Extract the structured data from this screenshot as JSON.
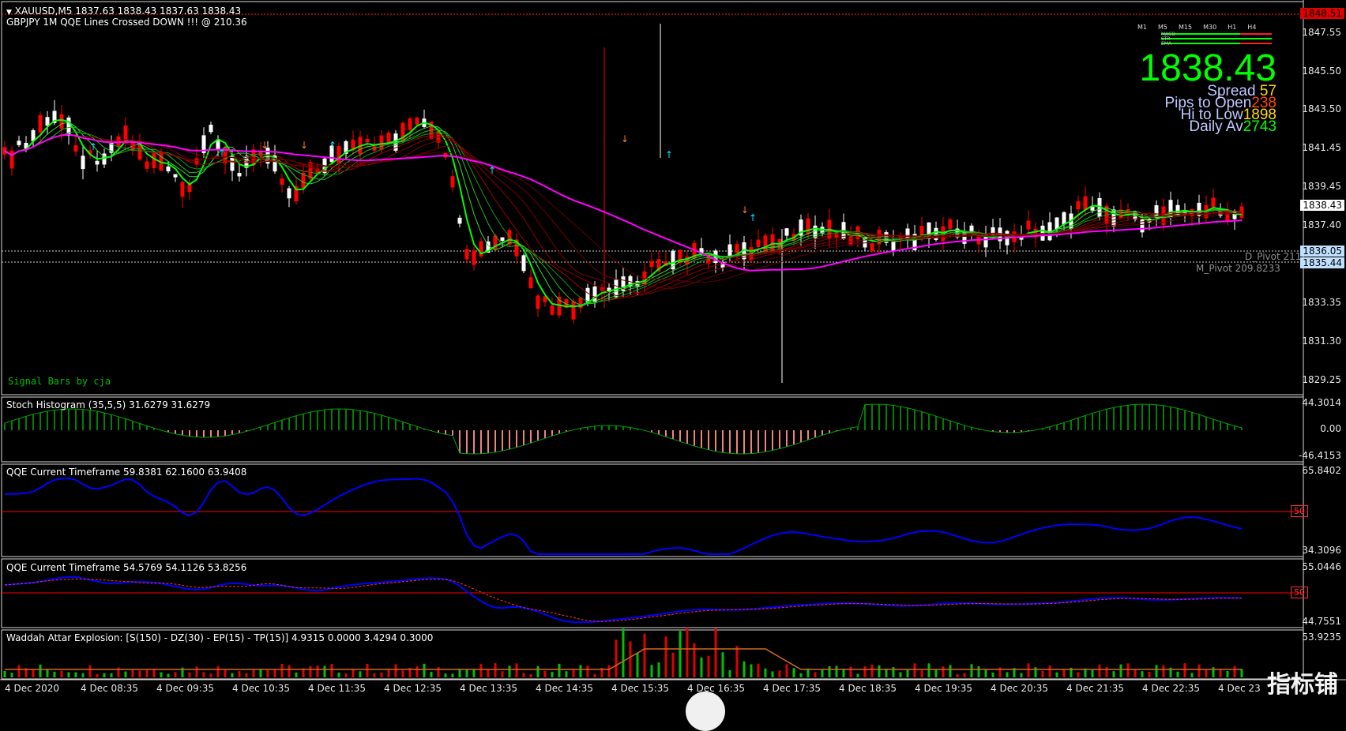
{
  "main_panel": {
    "title": "XAUUSD,M5  1837.63 1838.43 1837.63 1838.43",
    "subtitle": "GBPJPY 1M    QQE Lines Crossed DOWN !!!   @   210.36",
    "signal_text": "Signal Bars by cja",
    "big_price": "1838.43",
    "spread_label": "Spread",
    "spread_value": "57",
    "pips_label": "Pips to Open",
    "pips_value": "238",
    "hilow_label": "Hi to Low",
    "hilow_value": "1898",
    "daily_label": "Daily Av",
    "daily_value": "2743",
    "d_pivot": "D_Pivot 211",
    "m_pivot": "M_Pivot 209.8233",
    "top_price_badge": "1848.51",
    "current_price_badge": "1838.43",
    "pivot_badge_1": "1836.05",
    "pivot_badge_2": "1835.44",
    "y_ticks": [
      "1847.55",
      "1845.50",
      "1843.50",
      "1841.45",
      "1839.45",
      "1837.40",
      "1833.35",
      "1831.30",
      "1829.25"
    ],
    "timeframes": [
      "M1",
      "M5",
      "M15",
      "M30",
      "H1",
      "H4"
    ],
    "tf_rows": [
      "MACD",
      "STR",
      "EMA"
    ]
  },
  "stoch_panel": {
    "title": "Stoch Histogram (35,5,5) 31.6279 31.6279",
    "y_ticks": [
      "44.3014",
      "0.00",
      "-46.4153"
    ]
  },
  "qqe1_panel": {
    "title": "QQE Current Timeframe 59.8381 62.1600 63.9408",
    "y_ticks": [
      "65.8402",
      "34.3096"
    ],
    "level": "50"
  },
  "qqe2_panel": {
    "title": "QQE Current Timeframe 54.5769 54.1126 53.8256",
    "y_ticks": [
      "55.0446",
      "44.7551"
    ],
    "level": "50"
  },
  "waddah_panel": {
    "title": "Waddah Attar Explosion: [S(150) - DZ(30) - EP(15) - TP(15)] 4.9315 0.0000 3.4294 0.3000",
    "y_ticks": [
      "53.9235"
    ]
  },
  "time_axis": [
    "4 Dec 2020",
    "4 Dec 08:35",
    "4 Dec 09:35",
    "4 Dec 10:35",
    "4 Dec 11:35",
    "4 Dec 12:35",
    "4 Dec 13:35",
    "4 Dec 14:35",
    "4 Dec 15:35",
    "4 Dec 16:35",
    "4 Dec 17:35",
    "4 Dec 18:35",
    "4 Dec 19:35",
    "4 Dec 20:35",
    "4 Dec 21:35",
    "4 Dec 22:35",
    "4 Dec 23"
  ],
  "watermark": "指标铺",
  "colors": {
    "bull": "#ffffff",
    "bear": "#ff0000",
    "ma_fast": "#00ff00",
    "ma_slow": "#8b0000",
    "pivot_ma": "#ff00ff",
    "qqe_line": "#0000ff",
    "level_line": "#ff0000",
    "stoch_pos": "#008000",
    "stoch_neg": "#f08080",
    "big_price": "#00ff00"
  }
}
